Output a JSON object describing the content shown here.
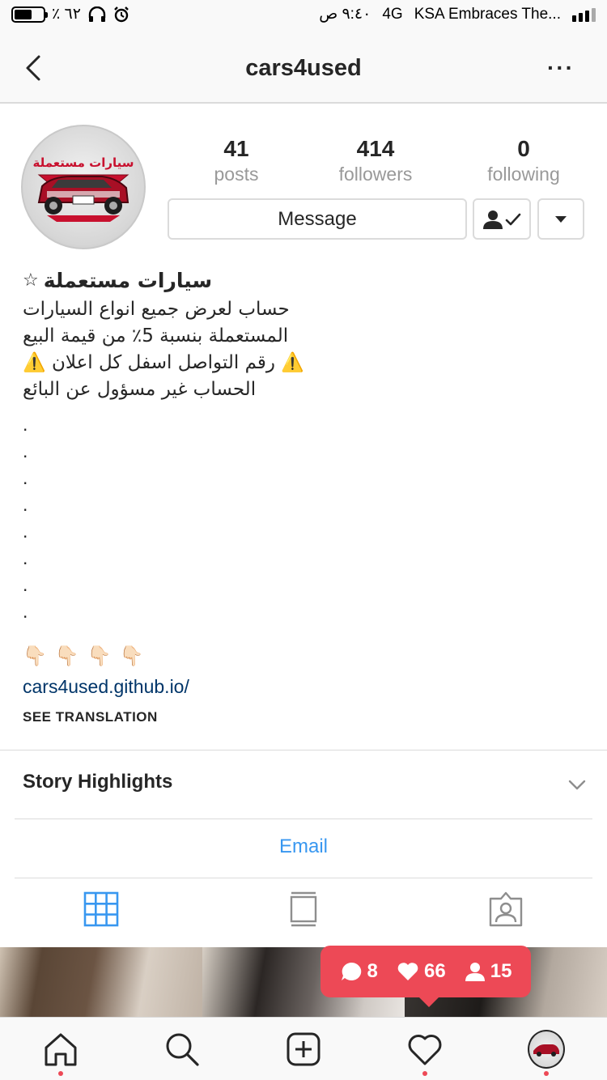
{
  "status_bar": {
    "battery_percent": "٪ ٦٢",
    "battery_level": 0.62,
    "time": "٩:٤٠ ص",
    "network": "4G",
    "carrier_text": "KSA Embraces The...",
    "icons": [
      "battery-icon",
      "headphones-icon",
      "alarm-icon",
      "signal-icon"
    ]
  },
  "nav": {
    "title": "cars4used",
    "back_icon": "chevron-left-icon",
    "more_label": "···"
  },
  "profile": {
    "avatar_text": "سيارات مستعملة",
    "stats": [
      {
        "value": "41",
        "label": "posts"
      },
      {
        "value": "414",
        "label": "followers"
      },
      {
        "value": "0",
        "label": "following"
      }
    ],
    "message_button": "Message",
    "following_icon": "person-check-icon",
    "dropdown_icon": "caret-down-icon"
  },
  "bio": {
    "name": "سيارات مستعملة",
    "name_star": "☆",
    "lines": [
      "حساب لعرض جميع انواع السيارات",
      "المستعملة بنسبة 5٪ من قيمة البيع",
      "⚠️ رقم التواصل اسفل كل اعلان ⚠️",
      "الحساب غير مسؤول عن البائع"
    ],
    "dots": [
      ".",
      ".",
      ".",
      ".",
      ".",
      ".",
      ".",
      "."
    ],
    "emoji_row": [
      "👇🏻",
      "👇🏻",
      "👇🏻",
      "👇🏻"
    ],
    "link": "cars4used.github.io/",
    "see_translation": "SEE TRANSLATION"
  },
  "story_highlights": {
    "label": "Story Highlights"
  },
  "email": {
    "label": "Email"
  },
  "view_tabs": [
    "grid-icon",
    "feed-icon",
    "tagged-icon"
  ],
  "activity": {
    "comments": "8",
    "likes": "66",
    "follows": "15"
  },
  "tab_bar": {
    "items": [
      "home-icon",
      "search-icon",
      "add-icon",
      "heart-icon",
      "profile-avatar"
    ]
  },
  "colors": {
    "accent": "#3897f0",
    "link": "#003569",
    "badge": "#ed4956",
    "muted": "#999999"
  }
}
